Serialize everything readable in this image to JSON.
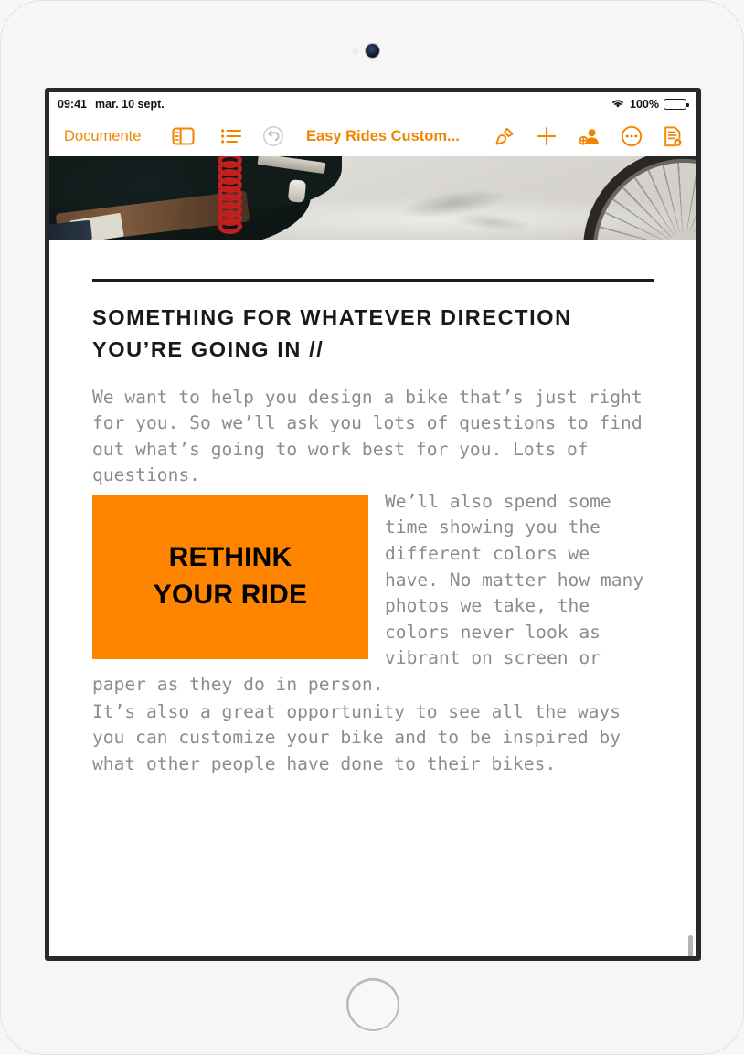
{
  "status_bar": {
    "time": "09:41",
    "date": "mar. 10 sept.",
    "wifi_icon": "wifi-icon",
    "battery_percent": "100%",
    "battery_icon": "battery-full-icon"
  },
  "toolbar": {
    "back_label": "Documente",
    "sidebar_icon": "sidebar-panel-icon",
    "list_icon": "bulleted-list-icon",
    "undo_icon": "undo-arrow-icon",
    "doc_title": "Easy Rides Custom...",
    "format_brush_icon": "format-paintbrush-icon",
    "insert_icon": "plus-add-icon",
    "collaborate_icon": "add-person-collaborate-icon",
    "more_icon": "more-ellipsis-icon",
    "document_options_icon": "document-view-options-icon"
  },
  "document": {
    "header_photo_alt": "bicycle-wheel-photo",
    "heading": "SOMETHING FOR WHATEVER DIRECTION YOU’RE GOING IN //",
    "callout_line1": "RETHINK",
    "callout_line2": "YOUR RIDE",
    "paragraph_1": "We want to help you design a bike that’s just right for you. So we’ll ask you lots of questions to find out what’s going to work best for you. Lots of questions.",
    "paragraph_2": "We’ll also spend some time showing you the different colors we have. No matter how many photos we take, the colors never look as vibrant on screen or paper as they do in person.",
    "paragraph_3": "It’s also a great opportunity to see all the ways you can customize your bike and to be inspired by what other people have done to their bikes."
  },
  "colors": {
    "accent_orange": "#F28500",
    "callout_orange": "#FF8400",
    "body_text_gray": "#8C8C8C",
    "heading_black": "#191919",
    "bezel": "#28282A"
  }
}
